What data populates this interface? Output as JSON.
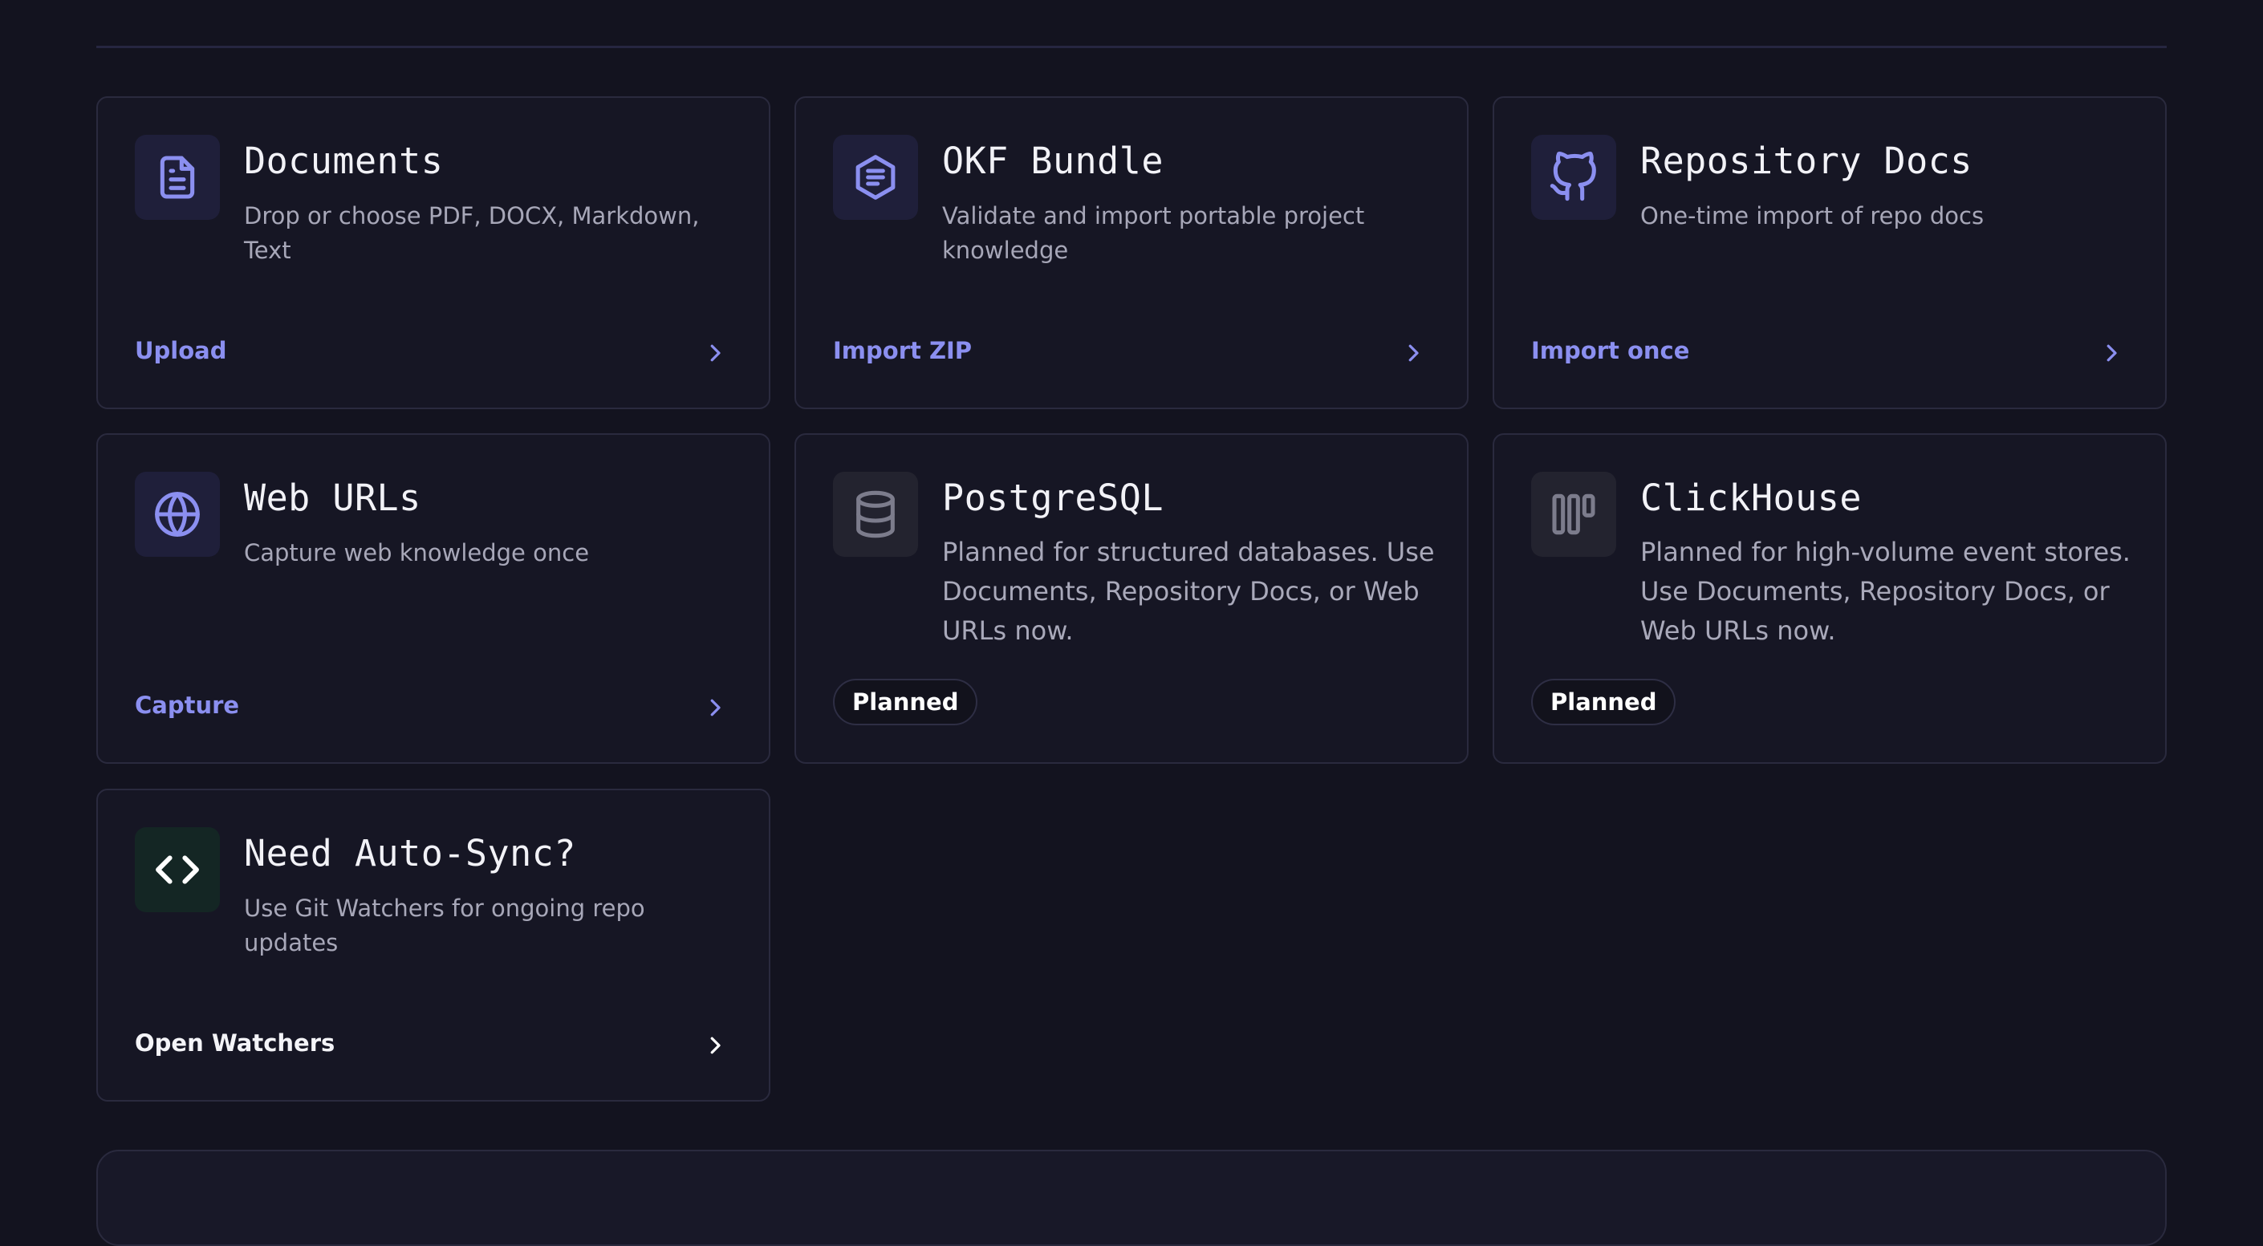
{
  "cards": [
    {
      "title": "Documents",
      "description": "Drop or choose PDF, DOCX, Markdown, Text",
      "action": "Upload",
      "icon": "document-icon"
    },
    {
      "title": "OKF Bundle",
      "description": "Validate and import portable project knowledge",
      "action": "Import ZIP",
      "icon": "bundle-hexagon-icon"
    },
    {
      "title": "Repository Docs",
      "description": "One-time import of repo docs",
      "action": "Import once",
      "icon": "github-icon"
    },
    {
      "title": "Web URLs",
      "description": "Capture web knowledge once",
      "action": "Capture",
      "icon": "globe-icon"
    },
    {
      "title": "PostgreSQL",
      "description": "Planned for structured databases. Use Documents, Repository Docs, or Web URLs now.",
      "badge": "Planned",
      "icon": "database-icon"
    },
    {
      "title": "ClickHouse",
      "description": "Planned for high-volume event stores. Use Documents, Repository Docs, or Web URLs now.",
      "badge": "Planned",
      "icon": "columns-icon"
    },
    {
      "title": "Need Auto-Sync?",
      "description": "Use Git Watchers for ongoing repo updates",
      "action": "Open Watchers",
      "icon": "code-icon"
    }
  ],
  "colors": {
    "background": "#13131f",
    "card": "#161624",
    "accent": "#8b8ff0",
    "muted_icon": "#7c7c8c",
    "code_icon": "#ffffff"
  }
}
